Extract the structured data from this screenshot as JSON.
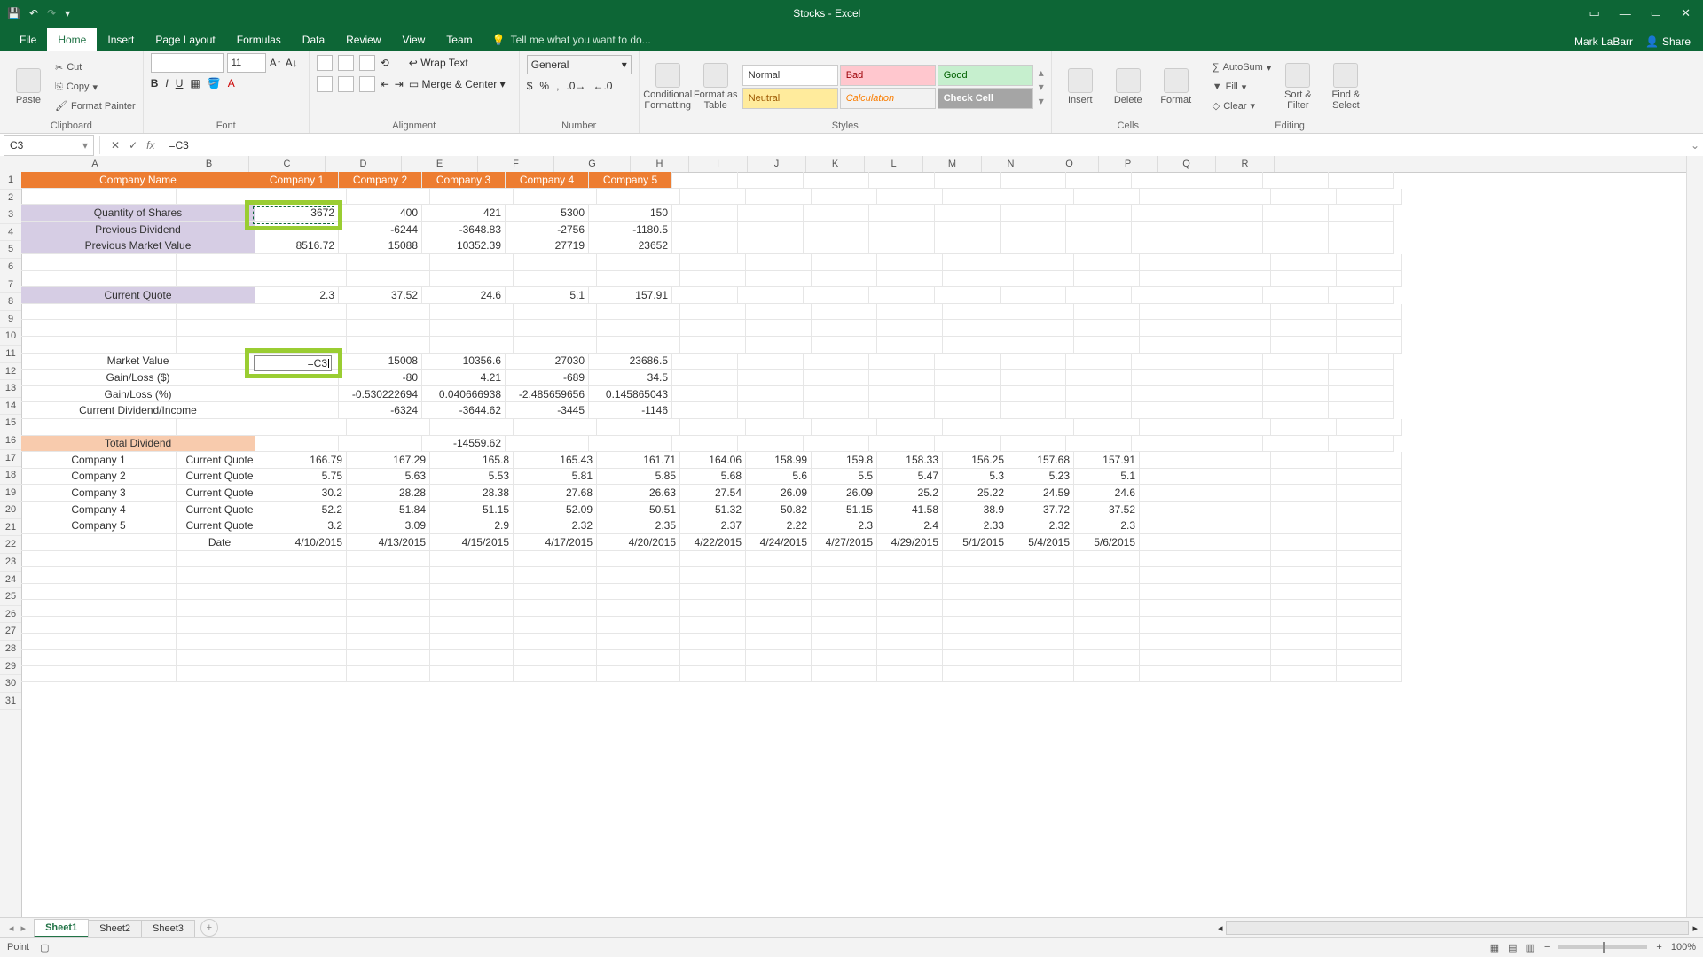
{
  "app": {
    "title": "Stocks - Excel",
    "user": "Mark LaBarr",
    "share": "Share"
  },
  "qat": {
    "save": "💾",
    "undo": "↶",
    "redo": "↷",
    "more": "▾"
  },
  "win": {
    "opts": "▭",
    "min": "—",
    "max": "▭",
    "close": "✕"
  },
  "tabs": {
    "file": "File",
    "home": "Home",
    "insert": "Insert",
    "pageLayout": "Page Layout",
    "formulas": "Formulas",
    "data": "Data",
    "review": "Review",
    "view": "View",
    "team": "Team",
    "tell": "Tell me what you want to do..."
  },
  "ribbon": {
    "clipboard": {
      "paste": "Paste",
      "cut": "Cut",
      "copy": "Copy",
      "fmtPainter": "Format Painter",
      "label": "Clipboard"
    },
    "font": {
      "size": "11",
      "label": "Font"
    },
    "alignment": {
      "wrap": "Wrap Text",
      "merge": "Merge & Center",
      "label": "Alignment"
    },
    "number": {
      "fmt": "General",
      "label": "Number"
    },
    "styles": {
      "cond": "Conditional Formatting",
      "fat": "Format as Table",
      "normal": "Normal",
      "bad": "Bad",
      "good": "Good",
      "neutral": "Neutral",
      "calc": "Calculation",
      "check": "Check Cell",
      "label": "Styles"
    },
    "cells": {
      "insert": "Insert",
      "delete": "Delete",
      "format": "Format",
      "label": "Cells"
    },
    "editing": {
      "autosum": "AutoSum",
      "fill": "Fill",
      "clear": "Clear",
      "sort": "Sort & Filter",
      "find": "Find & Select",
      "label": "Editing"
    }
  },
  "fbar": {
    "name": "C3",
    "formula": "=C3"
  },
  "cols": [
    "A",
    "B",
    "C",
    "D",
    "E",
    "F",
    "G",
    "H",
    "I",
    "J",
    "K",
    "L",
    "M",
    "N",
    "O",
    "P",
    "Q",
    "R"
  ],
  "colW": {
    "A": 166,
    "B": 89,
    "C": 85,
    "D": 85,
    "E": 85,
    "F": 85,
    "G": 85,
    "H": 65,
    "I": 65,
    "J": 65,
    "K": 65,
    "L": 65,
    "M": 65,
    "N": 65,
    "O": 65,
    "P": 65,
    "Q": 65,
    "R": 65
  },
  "rows": 31,
  "labels": {
    "companyName": "Company Name",
    "c1": "Company 1",
    "c2": "Company 2",
    "c3": "Company 3",
    "c4": "Company 4",
    "c5": "Company 5",
    "qty": "Quantity of Shares",
    "prevDiv": "Previous Dividend",
    "prevMV": "Previous Market Value",
    "curQuote": "Current Quote",
    "mv": "Market Value",
    "gl$": "Gain/Loss ($)",
    "glp": "Gain/Loss (%)",
    "cdi": "Current Dividend/Income",
    "totDiv": "Total Dividend",
    "cq": "Current Quote",
    "date": "Date"
  },
  "r3": {
    "C": "3672",
    "D": "400",
    "E": "421",
    "F": "5300",
    "G": "150"
  },
  "r4": {
    "D": "-6244",
    "E": "-3648.83",
    "F": "-2756",
    "G": "-1180.5"
  },
  "r5": {
    "C": "8516.72",
    "D": "15088",
    "E": "10352.39",
    "F": "27719",
    "G": "23652"
  },
  "r8": {
    "C": "2.3",
    "D": "37.52",
    "E": "24.6",
    "F": "5.1",
    "G": "157.91"
  },
  "r12": {
    "C": "=C3",
    "D": "15008",
    "E": "10356.6",
    "F": "27030",
    "G": "23686.5"
  },
  "r13": {
    "D": "-80",
    "E": "4.21",
    "F": "-689",
    "G": "34.5"
  },
  "r14": {
    "D": "-0.530222694",
    "E": "0.040666938",
    "F": "-2.485659656",
    "G": "0.145865043"
  },
  "r15": {
    "D": "-6324",
    "E": "-3644.62",
    "F": "-3445",
    "G": "-1146"
  },
  "r17": {
    "E": "-14559.62"
  },
  "r18": {
    "A": "Company 1",
    "B": "Current Quote",
    "C": "166.79",
    "D": "167.29",
    "E": "165.8",
    "F": "165.43",
    "G": "161.71",
    "H": "164.06",
    "I": "158.99",
    "J": "159.8",
    "K": "158.33",
    "L": "156.25",
    "M": "157.68",
    "N": "157.91"
  },
  "r19": {
    "A": "Company 2",
    "B": "Current Quote",
    "C": "5.75",
    "D": "5.63",
    "E": "5.53",
    "F": "5.81",
    "G": "5.85",
    "H": "5.68",
    "I": "5.6",
    "J": "5.5",
    "K": "5.47",
    "L": "5.3",
    "M": "5.23",
    "N": "5.1"
  },
  "r20": {
    "A": "Company 3",
    "B": "Current Quote",
    "C": "30.2",
    "D": "28.28",
    "E": "28.38",
    "F": "27.68",
    "G": "26.63",
    "H": "27.54",
    "I": "26.09",
    "J": "26.09",
    "K": "25.2",
    "L": "25.22",
    "M": "24.59",
    "N": "24.6"
  },
  "r21": {
    "A": "Company 4",
    "B": "Current Quote",
    "C": "52.2",
    "D": "51.84",
    "E": "51.15",
    "F": "52.09",
    "G": "50.51",
    "H": "51.32",
    "I": "50.82",
    "J": "51.15",
    "K": "41.58",
    "L": "38.9",
    "M": "37.72",
    "N": "37.52"
  },
  "r22": {
    "A": "Company 5",
    "B": "Current Quote",
    "C": "3.2",
    "D": "3.09",
    "E": "2.9",
    "F": "2.32",
    "G": "2.35",
    "H": "2.37",
    "I": "2.22",
    "J": "2.3",
    "K": "2.4",
    "L": "2.33",
    "M": "2.32",
    "N": "2.3"
  },
  "r23": {
    "B": "Date",
    "C": "4/10/2015",
    "D": "4/13/2015",
    "E": "4/15/2015",
    "F": "4/17/2015",
    "G": "4/20/2015",
    "H": "4/22/2015",
    "I": "4/24/2015",
    "J": "4/27/2015",
    "K": "4/29/2015",
    "L": "5/1/2015",
    "M": "5/4/2015",
    "N": "5/6/2015"
  },
  "sheets": {
    "s1": "Sheet1",
    "s2": "Sheet2",
    "s3": "Sheet3"
  },
  "status": {
    "mode": "Point",
    "zoom": "100%"
  }
}
